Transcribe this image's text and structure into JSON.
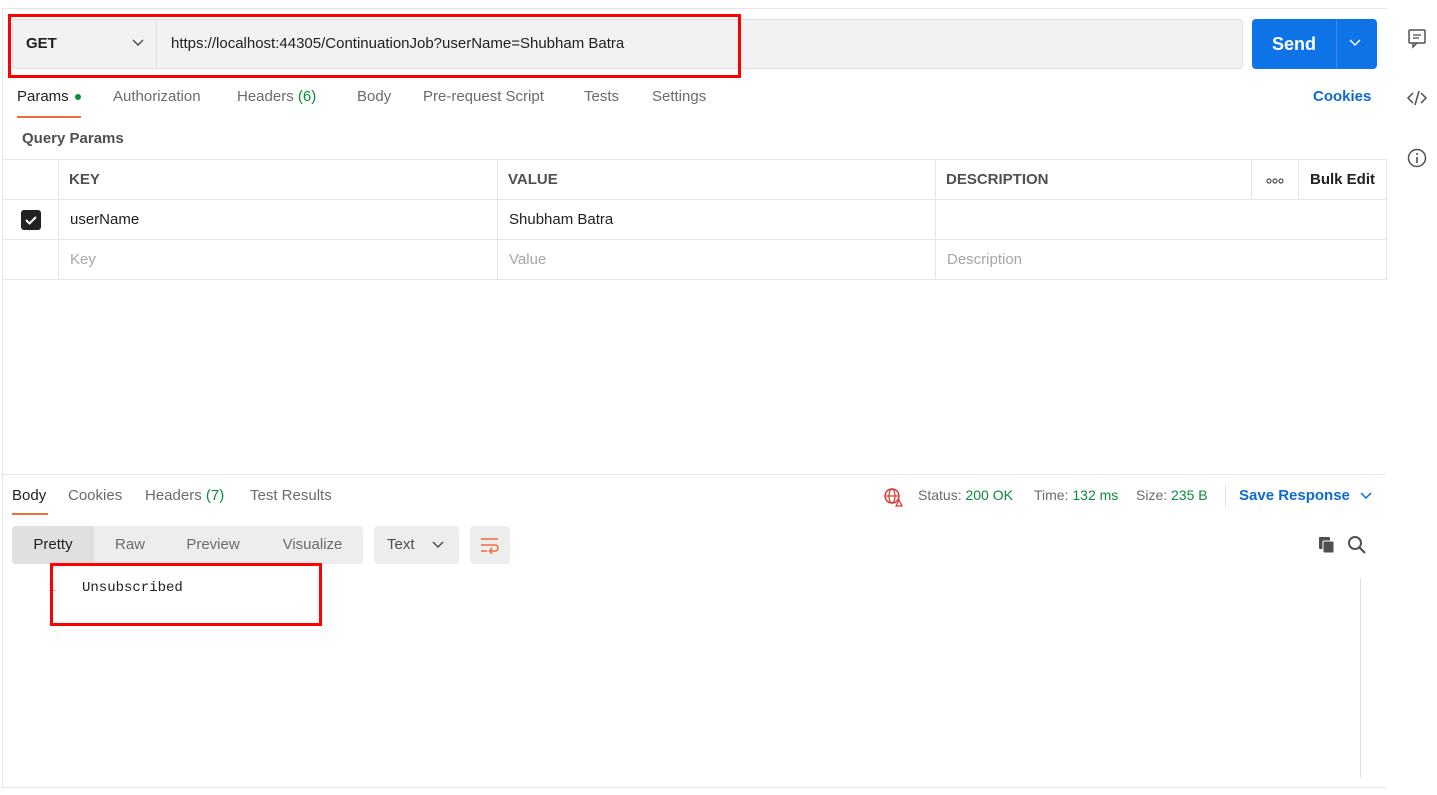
{
  "request": {
    "method": "GET",
    "url": "https://localhost:44305/ContinuationJob?userName=Shubham Batra",
    "send_label": "Send"
  },
  "request_tabs": [
    {
      "label": "Params"
    },
    {
      "label": "Authorization"
    },
    {
      "label": "Headers",
      "count": "(6)"
    },
    {
      "label": "Body"
    },
    {
      "label": "Pre-request Script"
    },
    {
      "label": "Tests"
    },
    {
      "label": "Settings"
    }
  ],
  "cookies_label": "Cookies",
  "query_params": {
    "title": "Query Params",
    "headers": {
      "key": "KEY",
      "value": "VALUE",
      "description": "DESCRIPTION",
      "bulk_edit": "Bulk Edit"
    },
    "rows": [
      {
        "checked": true,
        "key": "userName",
        "value": "Shubham Batra",
        "description": ""
      }
    ],
    "placeholder": {
      "key": "Key",
      "value": "Value",
      "description": "Description"
    }
  },
  "response": {
    "tabs": [
      {
        "label": "Body"
      },
      {
        "label": "Cookies"
      },
      {
        "label": "Headers",
        "count": "(7)"
      },
      {
        "label": "Test Results"
      }
    ],
    "status_label": "Status:",
    "status_value": "200 OK",
    "time_label": "Time:",
    "time_value": "132 ms",
    "size_label": "Size:",
    "size_value": "235 B",
    "save_label": "Save Response",
    "views": [
      "Pretty",
      "Raw",
      "Preview",
      "Visualize"
    ],
    "format": "Text",
    "lines": [
      {
        "num": "1",
        "text": "Unsubscribed"
      }
    ]
  },
  "colors": {
    "accent": "#f26b3a",
    "primary": "#0e73e6",
    "success": "#0a8a3c",
    "highlight": "#ff0000"
  }
}
